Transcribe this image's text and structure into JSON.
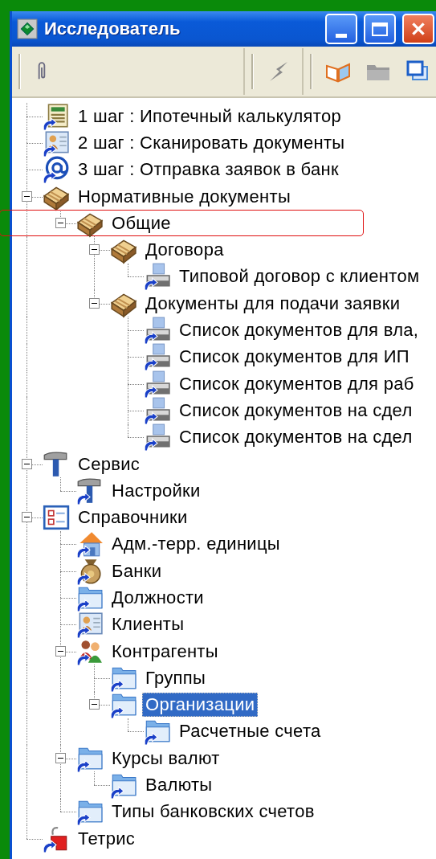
{
  "window": {
    "title": "Исследователь"
  },
  "toolbar": [
    [
      {
        "kind": "paperclip",
        "disabled": false
      }
    ],
    [
      {
        "kind": "bolt",
        "disabled": true
      }
    ],
    [
      {
        "kind": "book",
        "disabled": false
      },
      {
        "kind": "folder",
        "disabled": true
      },
      {
        "kind": "windows",
        "disabled": false
      }
    ]
  ],
  "tree": [
    {
      "label": "1 шаг : Ипотечный калькулятор",
      "kind": "calculator",
      "shortcut": true,
      "selected": false,
      "outlined": false
    },
    {
      "label": "2 шаг : Сканировать документы",
      "kind": "scan",
      "shortcut": true,
      "selected": false,
      "outlined": false
    },
    {
      "label": "3 шаг : Отправка заявок в банк",
      "kind": "at",
      "shortcut": true,
      "selected": false,
      "outlined": false
    },
    {
      "label": "Нормативные документы",
      "kind": "books",
      "shortcut": false,
      "selected": false,
      "outlined": false,
      "expanded": true,
      "children": [
        {
          "label": "Общие",
          "kind": "books",
          "shortcut": false,
          "selected": false,
          "outlined": true,
          "expanded": true,
          "children": [
            {
              "label": "Договора",
              "kind": "books",
              "shortcut": false,
              "selected": false,
              "outlined": false,
              "expanded": true,
              "children": [
                {
                  "label": "Типовой договор с клиентом",
                  "kind": "printer",
                  "shortcut": true,
                  "selected": false,
                  "outlined": false
                }
              ]
            },
            {
              "label": "Документы для подачи заявки",
              "kind": "books",
              "shortcut": false,
              "selected": false,
              "outlined": false,
              "expanded": true,
              "children": [
                {
                  "label": "Список документов для вла,",
                  "kind": "printer",
                  "shortcut": true,
                  "selected": false,
                  "outlined": false
                },
                {
                  "label": "Список документов для ИП",
                  "kind": "printer",
                  "shortcut": true,
                  "selected": false,
                  "outlined": false
                },
                {
                  "label": "Список документов для раб",
                  "kind": "printer",
                  "shortcut": true,
                  "selected": false,
                  "outlined": false
                },
                {
                  "label": "Список документов на сдел",
                  "kind": "printer",
                  "shortcut": true,
                  "selected": false,
                  "outlined": false
                },
                {
                  "label": "Список документов на сдел",
                  "kind": "printer",
                  "shortcut": true,
                  "selected": false,
                  "outlined": false
                }
              ]
            }
          ]
        }
      ]
    },
    {
      "label": "Сервис",
      "kind": "hammer",
      "shortcut": false,
      "selected": false,
      "outlined": false,
      "expanded": true,
      "children": [
        {
          "label": "Настройки",
          "kind": "hammer",
          "shortcut": true,
          "selected": false,
          "outlined": false
        }
      ]
    },
    {
      "label": "Справочники",
      "kind": "checklist",
      "shortcut": false,
      "selected": false,
      "outlined": false,
      "expanded": true,
      "children": [
        {
          "label": "Адм.-терр. единицы",
          "kind": "house",
          "shortcut": true,
          "selected": false,
          "outlined": false
        },
        {
          "label": "Банки",
          "kind": "moneybag",
          "shortcut": true,
          "selected": false,
          "outlined": false
        },
        {
          "label": "Должности",
          "kind": "folder",
          "shortcut": true,
          "selected": false,
          "outlined": false
        },
        {
          "label": "Клиенты",
          "kind": "card",
          "shortcut": true,
          "selected": false,
          "outlined": false
        },
        {
          "label": "Контрагенты",
          "kind": "people",
          "shortcut": true,
          "selected": false,
          "outlined": false,
          "expanded": true,
          "children": [
            {
              "label": "Группы",
              "kind": "folder",
              "shortcut": true,
              "selected": false,
              "outlined": false
            },
            {
              "label": "Организации",
              "kind": "folder",
              "shortcut": true,
              "selected": true,
              "outlined": false,
              "expanded": true,
              "children": [
                {
                  "label": "Расчетные счета",
                  "kind": "folder",
                  "shortcut": true,
                  "selected": false,
                  "outlined": false
                }
              ]
            }
          ]
        },
        {
          "label": "Курсы валют",
          "kind": "folder",
          "shortcut": true,
          "selected": false,
          "outlined": false,
          "expanded": true,
          "children": [
            {
              "label": "Валюты",
              "kind": "folder",
              "shortcut": true,
              "selected": false,
              "outlined": false
            }
          ]
        },
        {
          "label": "Типы банковских счетов",
          "kind": "folder",
          "shortcut": true,
          "selected": false,
          "outlined": false
        }
      ]
    },
    {
      "label": "Тетрис",
      "kind": "tetris",
      "shortcut": true,
      "selected": false,
      "outlined": false
    }
  ]
}
